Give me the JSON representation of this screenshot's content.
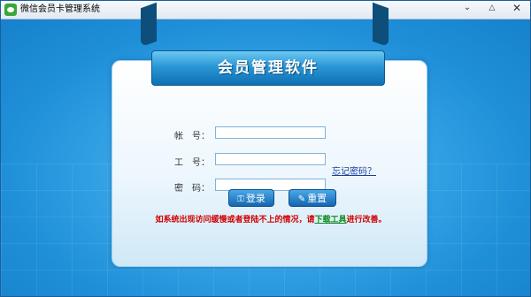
{
  "window": {
    "title": "微信会员卡管理系统"
  },
  "controls": {
    "minimize": "⌄",
    "maximize": "△",
    "close": "✕"
  },
  "banner": {
    "title": "会员管理软件"
  },
  "form": {
    "account_label": "帐　号：",
    "employee_label": "工　号：",
    "password_label": "密　码：",
    "account_value": "",
    "employee_value": "",
    "password_value": "",
    "forgot_link": "忘记密码？"
  },
  "buttons": {
    "login_label": "登录",
    "reset_label": "重置"
  },
  "notice": {
    "prefix": "如系统出现访问缓慢或者登陆不上的情况，请",
    "link": "下载工具",
    "suffix": "进行改善。"
  }
}
